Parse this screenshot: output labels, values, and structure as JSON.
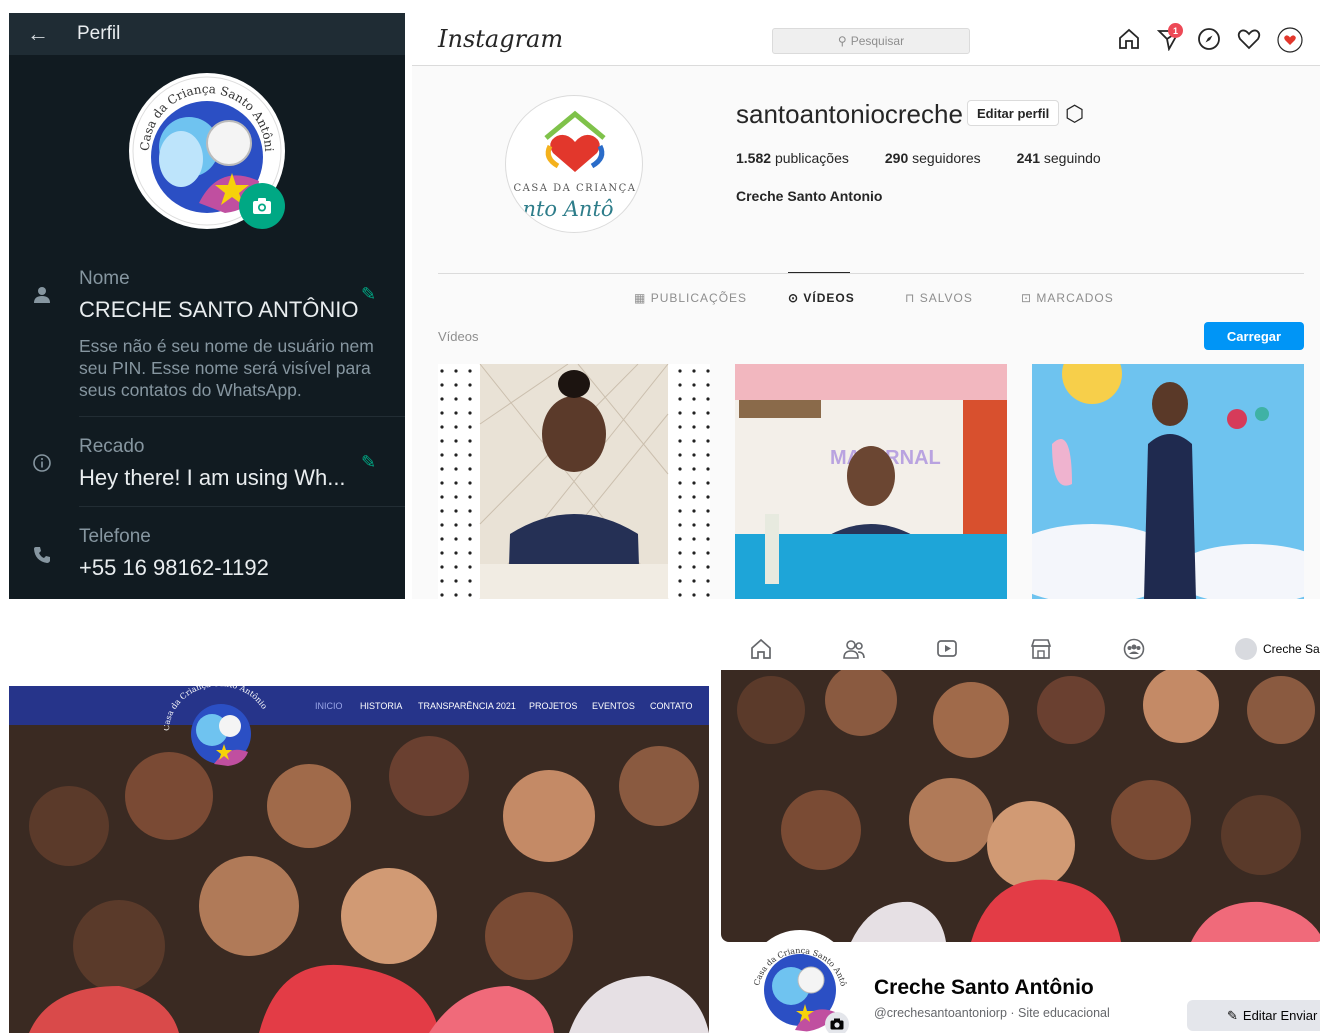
{
  "whatsapp": {
    "title": "Perfil",
    "name_label": "Nome",
    "name_value": "CRECHE SANTO ANTÔNIO",
    "name_hint": "Esse não é seu nome de usuário nem seu PIN. Esse nome será visível para seus contatos do WhatsApp.",
    "about_label": "Recado",
    "about_value": "Hey there! I am using Wh...",
    "phone_label": "Telefone",
    "phone_value": "+55 16 98162-1192",
    "logo_text": "Casa da Criança Santo Antônio",
    "accent_color": "#00a884"
  },
  "instagram": {
    "logo": "Instagram",
    "search_placeholder": "Pesquisar",
    "notification_count": "1",
    "username": "santoantoniocreche",
    "edit_profile": "Editar perfil",
    "stats": [
      {
        "count": "1.582",
        "label": "publicações"
      },
      {
        "count": "290",
        "label": "seguidores"
      },
      {
        "count": "241",
        "label": "seguindo"
      }
    ],
    "full_name": "Creche Santo Antonio",
    "logo_caption_top": "CASA DA CRIANÇA",
    "logo_caption_bottom": "nto Antô",
    "tabs": [
      {
        "icon": "▦",
        "label": "PUBLICAÇÕES"
      },
      {
        "icon": "⊙",
        "label": "VÍDEOS"
      },
      {
        "icon": "⊓",
        "label": "SALVOS"
      },
      {
        "icon": "⊡",
        "label": "MARCADOS"
      }
    ],
    "videos_label": "Vídeos",
    "upload_button": "Carregar",
    "video_thumb_text": "MATERNAL",
    "accent_color": "#0095f6"
  },
  "website": {
    "menu": [
      "INICIO",
      "HISTORIA",
      "TRANSPARÊNCIA 2021",
      "PROJETOS",
      "EVENTOS",
      "CONTATO"
    ],
    "active_item": "INICIO",
    "logo_text": "Casa da Criança Santo Antônio",
    "nav_color": "#26348a"
  },
  "facebook": {
    "account_name": "Creche San",
    "page_name": "Creche Santo Antônio",
    "handle_line": "@crechesantoantoniorp · Site educacional",
    "edit_button": "Editar Enviar",
    "logo_text": "Casa da Criança Santo Antônio"
  }
}
